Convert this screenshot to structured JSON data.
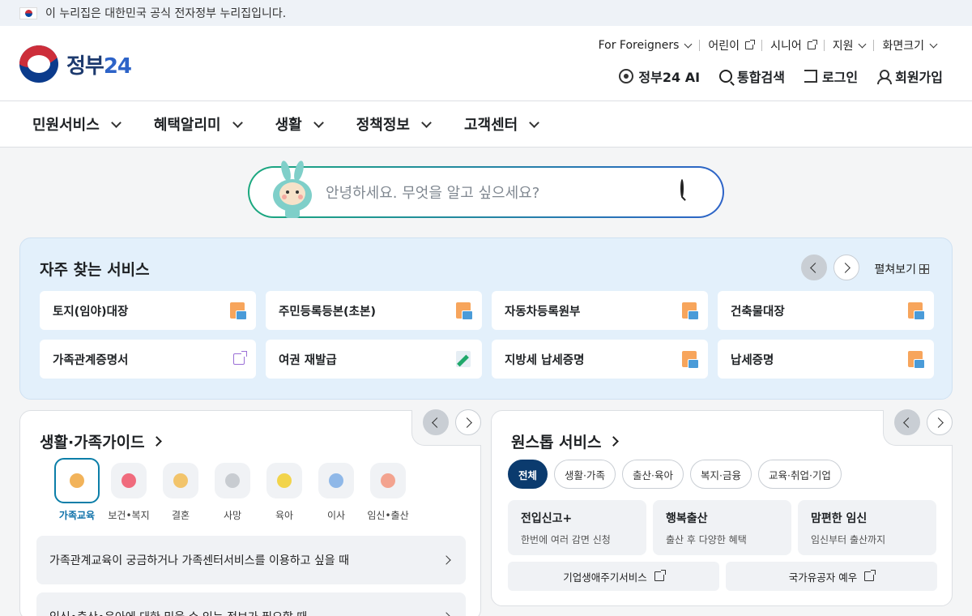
{
  "topbar": {
    "text": "이 누리집은 대한민국 공식 전자정부 누리집입니다."
  },
  "logo": {
    "text": "정부",
    "num": "24"
  },
  "util": {
    "foreigners": "For Foreigners",
    "kids": "어린이",
    "senior": "시니어",
    "support": "지원",
    "font_size": "화면크기"
  },
  "actions": {
    "ai": "정부24 AI",
    "search": "통합검색",
    "login": "로그인",
    "signup": "회원가입"
  },
  "gnb": [
    "민원서비스",
    "혜택알리미",
    "생활",
    "정책정보",
    "고객센터"
  ],
  "search": {
    "placeholder": "안녕하세요. 무엇을 알고 싶으세요?"
  },
  "frequent": {
    "title": "자주 찾는 서비스",
    "expand": "펼쳐보기",
    "items": [
      {
        "label": "토지(임야)대장",
        "icon": "pdf-icon"
      },
      {
        "label": "주민등록등본(초본)",
        "icon": "pdf-icon"
      },
      {
        "label": "자동차등록원부",
        "icon": "pdf-icon"
      },
      {
        "label": "건축물대장",
        "icon": "pdf-icon"
      },
      {
        "label": "가족관계증명서",
        "icon": "external-link-icon"
      },
      {
        "label": "여권 재발급",
        "icon": "pen-icon"
      },
      {
        "label": "지방세 납세증명",
        "icon": "pdf-icon"
      },
      {
        "label": "납세증명",
        "icon": "pdf-icon"
      }
    ]
  },
  "life_guide": {
    "title": "생활·가족가이드",
    "categories": [
      {
        "label": "가족교육",
        "icon": "family-icon",
        "active": true
      },
      {
        "label": "보건•복지",
        "icon": "heart-icon",
        "active": false
      },
      {
        "label": "결혼",
        "icon": "rings-icon",
        "active": false
      },
      {
        "label": "사망",
        "icon": "flower-icon",
        "active": false
      },
      {
        "label": "육아",
        "icon": "stroller-icon",
        "active": false
      },
      {
        "label": "이사",
        "icon": "house-icon",
        "active": false
      },
      {
        "label": "임신•출산",
        "icon": "pregnant-icon",
        "active": false
      }
    ],
    "guides": [
      "가족관계교육이 궁금하거나 가족센터서비스를 이용하고 싶을 때",
      "임신•출산•육아에 대한 믿을 수 있는 정보가 필요할 때"
    ]
  },
  "onestop": {
    "title": "원스톱 서비스",
    "chips": [
      "전체",
      "생활·가족",
      "출산·육아",
      "복지·금융",
      "교육·취업·기업"
    ],
    "items": [
      {
        "title": "전입신고+",
        "sub": "한번에 여러 감면 신청"
      },
      {
        "title": "행복출산",
        "sub": "출산 후 다양한 혜택"
      },
      {
        "title": "맘편한 임신",
        "sub": "임신부터 출산까지"
      }
    ],
    "links": [
      "기업생애주기서비스",
      "국가유공자 예우"
    ]
  },
  "colors": {
    "accent": "#0b3b6e",
    "teal": "#0b7ea8",
    "panel": "#e3f0fb"
  }
}
